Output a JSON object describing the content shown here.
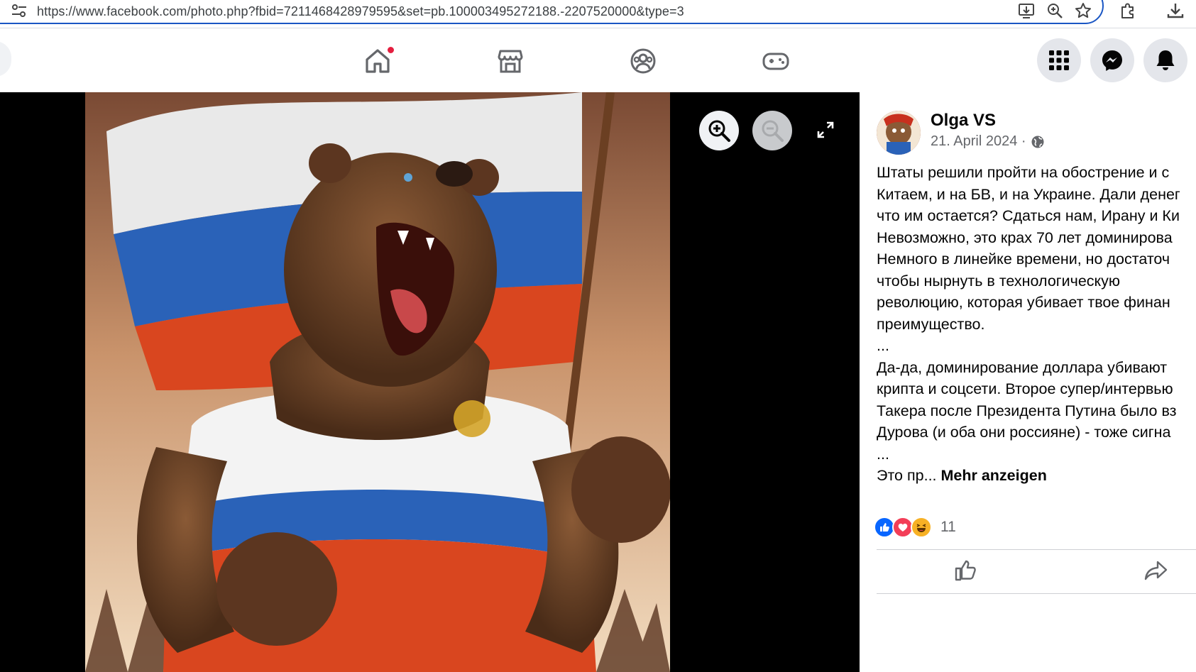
{
  "browser": {
    "url": "https://www.facebook.com/photo.php?fbid=7211468428979595&set=pb.100003495272188.-2207520000&type=3",
    "icons": [
      "tune-icon",
      "install-app-icon",
      "zoom-icon",
      "bookmark-star-icon",
      "extensions-icon",
      "download-icon"
    ]
  },
  "nav": {
    "icons": [
      "home-icon",
      "marketplace-icon",
      "groups-icon",
      "gaming-icon",
      "menu-grid-icon",
      "messenger-icon",
      "notifications-bell-icon"
    ],
    "home_has_notification": true
  },
  "viewer": {
    "icons": [
      "zoom-in-icon",
      "zoom-out-icon",
      "fullscreen-icon"
    ]
  },
  "post": {
    "author": "Olga VS",
    "date": "21. April 2024 ·",
    "lines": [
      "Штаты решили пройти на обострение и с",
      "Китаем, и на БВ, и на Украине. Дали денег",
      "что им остается? Сдаться нам, Ирану и Ки",
      "Невозможно, это крах 70 лет доминирова",
      "Немного в линейке времени, но достаточ",
      "чтобы нырнуть в технологическую",
      "революцию, которая убивает твое финан",
      "преимущество.",
      "...",
      "Да-да, доминирование доллара убивают",
      "крипта и соцсети. Второе супер/интервью",
      "Такера после Президента Путина было вз",
      "Дурова (и оба они россияне) - тоже сигна",
      "..."
    ],
    "last_line_prefix": "Это пр...",
    "more_label": "Mehr anzeigen",
    "reaction_count": "11",
    "reactions": [
      "like-reaction-icon",
      "love-reaction-icon",
      "haha-reaction-icon"
    ]
  },
  "colors": {
    "facebook_blue": "#0866ff",
    "notification_red": "#e41e3f",
    "url_border": "#1a56c4"
  }
}
